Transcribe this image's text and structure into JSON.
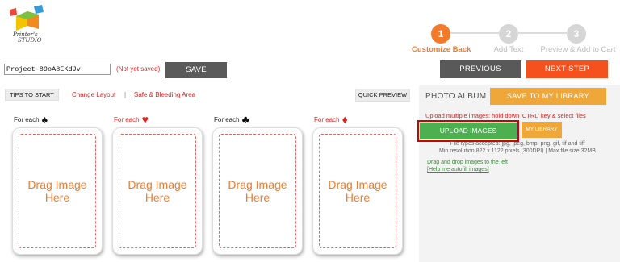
{
  "logo": {
    "text_line1": "Printer's",
    "text_line2": "STUDIO"
  },
  "steps": [
    {
      "number": "1",
      "label": "Customize Back"
    },
    {
      "number": "2",
      "label": "Add Text"
    },
    {
      "number": "3",
      "label": "Preview & Add to Cart"
    }
  ],
  "toolbar": {
    "project_name": "Project-89oA8EKdJv",
    "save_status": "(Not yet saved)",
    "save_label": "SAVE",
    "previous_label": "PREVIOUS",
    "next_label": "NEXT STEP"
  },
  "subbar": {
    "tips_label": "TIPS TO START",
    "change_layout": "Change Layout",
    "separator": "|",
    "safe_bleeding": "Safe & Bleeding Area",
    "quick_preview": "QUICK PREVIEW"
  },
  "cards": [
    {
      "title": "For each",
      "suit": "♠",
      "placeholder_line1": "Drag Image",
      "placeholder_line2": "Here"
    },
    {
      "title": "For each",
      "suit": "♥",
      "placeholder_line1": "Drag Image",
      "placeholder_line2": "Here"
    },
    {
      "title": "For each",
      "suit": "♣",
      "placeholder_line1": "Drag Image",
      "placeholder_line2": "Here"
    },
    {
      "title": "For each",
      "suit": "♦",
      "placeholder_line1": "Drag Image",
      "placeholder_line2": "Here"
    }
  ],
  "panel": {
    "photo_album": "PHOTO ALBUM",
    "save_to_library": "SAVE TO MY LIBRARY",
    "upload_hint": "Upload multiple images: hold down 'CTRL' key & select files",
    "upload_label": "UPLOAD IMAGES",
    "my_library_label": "MY LIBRARY",
    "file_types": "File types accepted: jpg, jpeg, bmp, png, gif, tif and tiff",
    "min_resolution": "Min resolution 822 x 1122 pixels (300DPI) | Max file size 32MB",
    "drag_drop": "Drag and drop images to the left",
    "help_link": "[Help me autofill images]"
  },
  "colors": {
    "accent_orange": "#f37a2a",
    "next_red_orange": "#f4511e",
    "library_orange": "#f0a73a",
    "upload_green": "#4caf50",
    "link_red": "#e02020",
    "highlight_border": "#d40000"
  }
}
